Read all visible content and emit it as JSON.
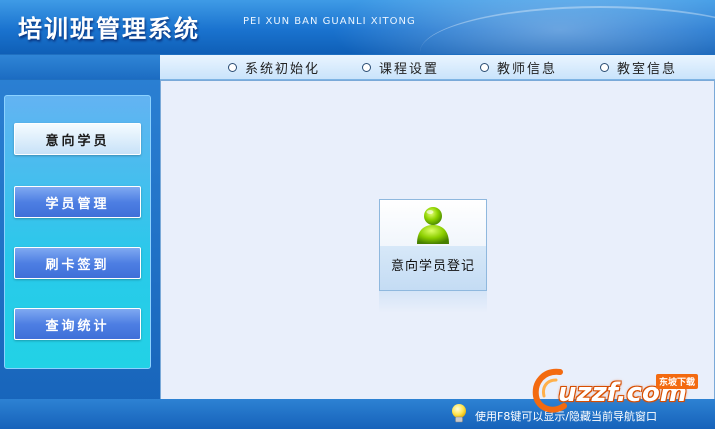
{
  "header": {
    "title": "培训班管理系统",
    "subtitle": "PEI XUN BAN GUANLI XITONG"
  },
  "menu": {
    "items": [
      {
        "label": "系统初始化"
      },
      {
        "label": "课程设置"
      },
      {
        "label": "教师信息"
      },
      {
        "label": "教室信息"
      }
    ]
  },
  "sidebar": {
    "items": [
      {
        "label": "意向学员",
        "active": true
      },
      {
        "label": "学员管理",
        "active": false
      },
      {
        "label": "刷卡签到",
        "active": false
      },
      {
        "label": "查询统计",
        "active": false
      }
    ]
  },
  "main": {
    "tile": {
      "label": "意向学员登记",
      "icon": "user-icon"
    }
  },
  "status": {
    "hint": "使用F8键可以显示/隐藏当前导航窗口",
    "icon": "lightbulb-icon"
  },
  "watermark": {
    "text": "uzzf.com",
    "badge": "东坡下载"
  },
  "colors": {
    "header_blue": "#1a73cf",
    "sidebar_cyan": "#29c9ea",
    "button_blue": "#4e7fe3",
    "main_bg": "#e9effb",
    "icon_green": "#8fd400"
  }
}
